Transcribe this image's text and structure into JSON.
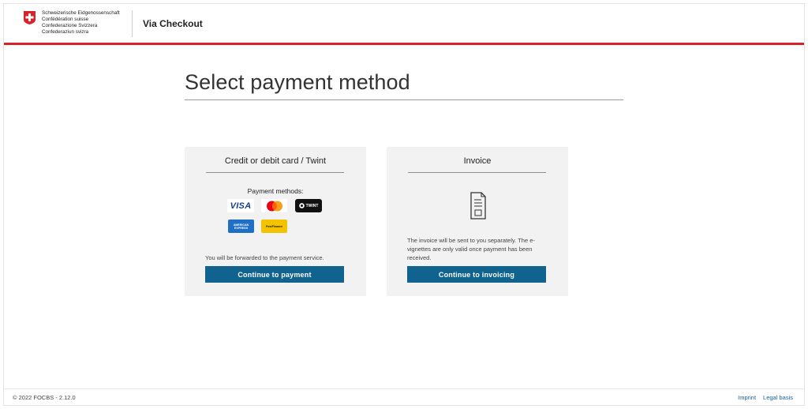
{
  "header": {
    "logo_lines": [
      "Schweizerische Eidgenossenschaft",
      "Confédération suisse",
      "Confederazione Svizzera",
      "Confederaziun svizra"
    ],
    "app_title": "Via Checkout"
  },
  "main": {
    "title": "Select payment method",
    "card_payment": {
      "title": "Credit or debit card / Twint",
      "methods_label": "Payment methods:",
      "logos": {
        "visa": "VISA",
        "twint": "TWINT",
        "amex": "AMERICAN EXPRESS",
        "postfinance": "PostFinance"
      },
      "note": "You will be forwarded to the payment service.",
      "button": "Continue to payment"
    },
    "card_invoice": {
      "title": "Invoice",
      "note": "The invoice will be sent to you separately. The e-vignettes are only valid once payment has been received.",
      "button": "Continue to invoicing"
    }
  },
  "footer": {
    "version": "© 2022 FOCBS - 2.12.0",
    "links": [
      "Imprint",
      "Legal basis"
    ]
  },
  "colors": {
    "accent_red": "#d8232a",
    "button_blue": "#10628f",
    "card_bg": "#f2f2f2",
    "link": "#1a5fa8"
  },
  "icons": [
    "swiss-flag-icon",
    "visa-logo",
    "mastercard-logo",
    "twint-logo",
    "amex-logo",
    "postfinance-logo",
    "invoice-document-icon"
  ]
}
